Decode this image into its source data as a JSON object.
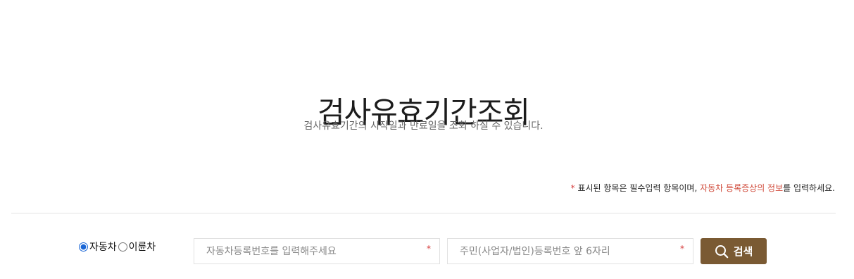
{
  "header": {
    "title": "검사유효기간조회",
    "subtitle": "검사유효기간의 시작일과 만료일을 조회 하실 수 있습니다."
  },
  "notice": {
    "star": "*",
    "text_before": " 표시된 항목은 필수입력 항목이며, ",
    "link_text": "자동차 등록증상의 정보",
    "text_after": "를 입력하세요."
  },
  "vehicle_type": {
    "options": [
      {
        "label": "자동차",
        "selected": true
      },
      {
        "label": "이륜차",
        "selected": false
      }
    ]
  },
  "form": {
    "car_number": {
      "value": "",
      "placeholder": "자동차등록번호를 입력해주세요",
      "required_mark": "*"
    },
    "id_number": {
      "value": "",
      "placeholder": "주민(사업자/법인)등록번호 앞 6자리",
      "required_mark": "*"
    }
  },
  "search_button": {
    "label": "검색",
    "icon": "search-icon"
  },
  "colors": {
    "accent": "#7a5a33",
    "required": "#d63a3a",
    "link": "#d04a3a"
  }
}
